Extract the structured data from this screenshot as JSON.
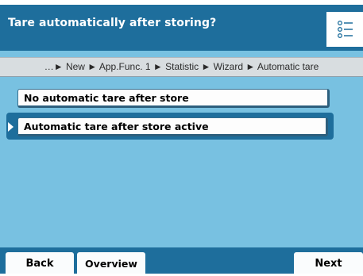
{
  "header": {
    "title": "Tare automatically after storing?",
    "list_icon": "list-icon"
  },
  "breadcrumb": "…► New ► App.Func. 1 ► Statistic ► Wizard ► Automatic tare",
  "options": [
    {
      "label": "No automatic tare after store",
      "selected": false
    },
    {
      "label": "Automatic tare after store active",
      "selected": true
    }
  ],
  "footer": {
    "back_label": "Back",
    "overview_label": "Overview",
    "next_label": "Next"
  },
  "colors": {
    "header_bg": "#1e6e9c",
    "content_bg": "#78c1e1",
    "button_bg": "#fdfdfd"
  }
}
